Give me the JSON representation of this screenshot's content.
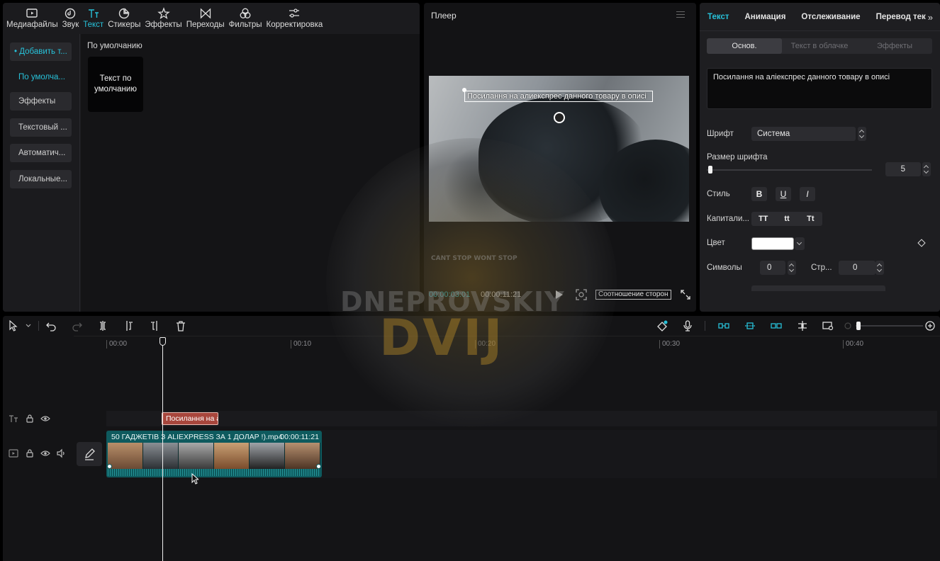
{
  "media_tabs": [
    {
      "label": "Медиафайлы",
      "icon": "media-icon"
    },
    {
      "label": "Звук",
      "icon": "audio-icon"
    },
    {
      "label": "Текст",
      "icon": "text-icon",
      "active": true
    },
    {
      "label": "Стикеры",
      "icon": "sticker-icon"
    },
    {
      "label": "Эффекты",
      "icon": "effects-icon"
    },
    {
      "label": "Переходы",
      "icon": "transitions-icon"
    },
    {
      "label": "Фильтры",
      "icon": "filters-icon"
    },
    {
      "label": "Корректировка",
      "icon": "adjust-icon"
    }
  ],
  "text_side": {
    "add_text": "• Добавить т...",
    "default": "По умолча...",
    "effects": "Эффекты",
    "text_template": "Текстовый ...",
    "auto": "Автоматич...",
    "local": "Локальные..."
  },
  "text_content": {
    "section_title": "По умолчанию",
    "default_card": "Текст по умолчанию"
  },
  "player": {
    "title": "Плеер",
    "caption": "Посилання на алиекспрес данного товару в описі",
    "timecode_current": "00:00:03:01",
    "timecode_total": "00:00:11:21",
    "ratio_label": "Соотношение сторон"
  },
  "inspector": {
    "tabs": [
      "Текст",
      "Анимация",
      "Отслеживание",
      "Перевод тек"
    ],
    "segments": [
      "Основ.",
      "Текст в облачке",
      "Эффекты"
    ],
    "text_value": "Посилання на алiекспрес данного товару в описi",
    "font_label": "Шрифт",
    "font_value": "Система",
    "size_label": "Размер шрифта",
    "size_value": "5",
    "style_label": "Стиль",
    "style_buttons": [
      "B",
      "U",
      "I"
    ],
    "caps_label": "Капитали...",
    "caps_buttons": [
      "TT",
      "tt",
      "Tt"
    ],
    "color_label": "Цвет",
    "color_value": "#ffffff",
    "chars_label": "Символы",
    "chars_value": "0",
    "lines_label": "Стр...",
    "lines_value": "0"
  },
  "timeline": {
    "ticks": [
      "00:00",
      "00:10",
      "00:20",
      "00:30",
      "00:40"
    ],
    "text_clip": "Посилання на а",
    "video_clip_title": "50 ГАДЖЕТІВ З ALIEXPRESS ЗА 1 ДОЛАР !).mp4",
    "video_clip_duration": "00:00:11:21"
  },
  "watermark": {
    "line1": "DNEPROVSKIY",
    "line2": "DVIJ",
    "line3": "CANT STOP WONT STOP"
  },
  "colors": {
    "accent": "#27c1d9",
    "text_clip": "#a8463c",
    "video_clip": "#0e5a5e"
  }
}
